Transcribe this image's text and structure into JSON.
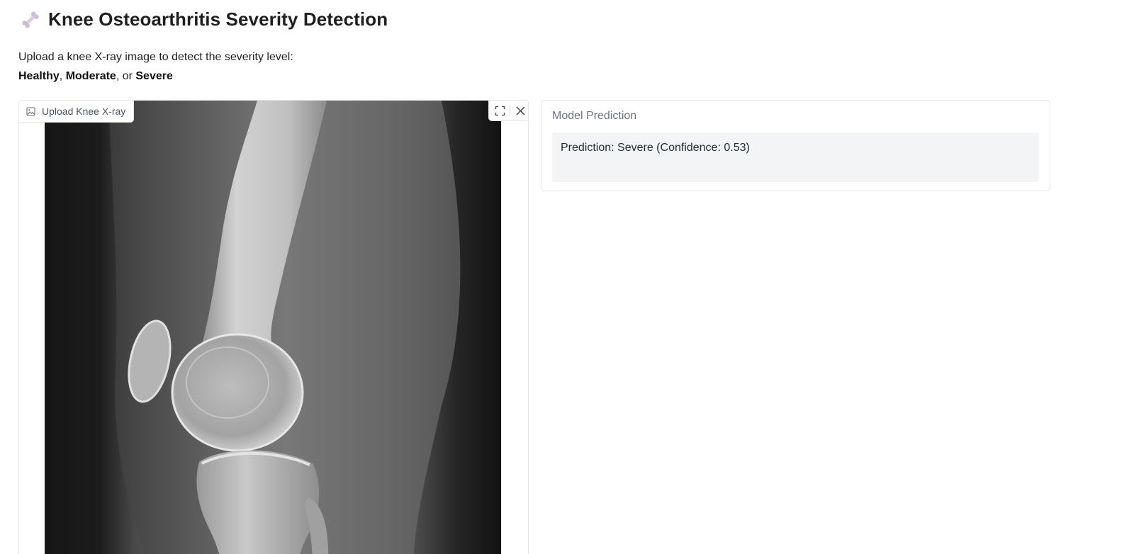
{
  "header": {
    "icon": "bone-icon",
    "title": "Knee Osteoarthritis Severity Detection"
  },
  "description": {
    "line1": "Upload a knee X-ray image to detect the severity level:",
    "option_healthy": "Healthy",
    "sep1": ", ",
    "option_moderate": "Moderate",
    "sep2": ", or ",
    "option_severe": "Severe"
  },
  "image_input": {
    "label": "Upload Knee X-ray",
    "label_icon": "image-icon",
    "toolbar": {
      "fullscreen_icon": "fullscreen-icon",
      "clear_icon": "close-icon"
    }
  },
  "prediction": {
    "label": "Model Prediction",
    "text": "Prediction: Severe (Confidence: 0.53)"
  },
  "colors": {
    "border": "#e5e7eb",
    "output_bg": "#f3f4f6",
    "label_gray": "#6b7280",
    "bone_icon": "#c7b9d6"
  }
}
